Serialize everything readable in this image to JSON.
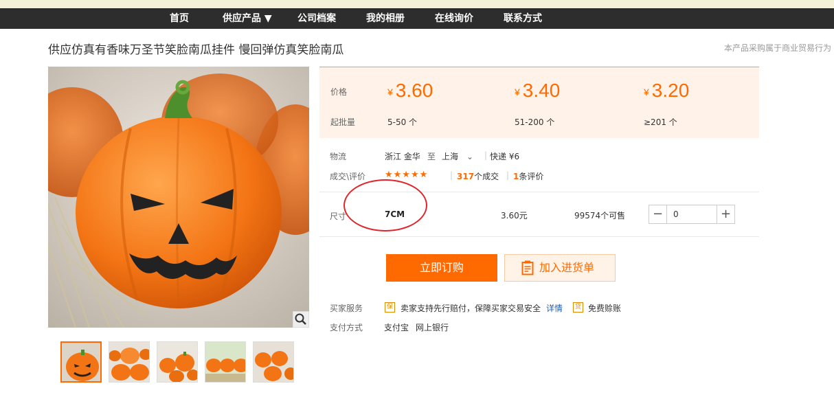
{
  "nav": {
    "items": [
      {
        "label": "首页"
      },
      {
        "label": "供应产品 ▼"
      },
      {
        "label": "公司档案"
      },
      {
        "label": "我的相册"
      },
      {
        "label": "在线询价"
      },
      {
        "label": "联系方式"
      }
    ]
  },
  "product": {
    "title": "供应仿真有香味万圣节笑脸南瓜挂件 慢回弹仿真笑脸南瓜",
    "disclaimer": "本产品采购属于商业贸易行为"
  },
  "pricing": {
    "price_label": "价格",
    "moq_label": "起批量",
    "currency": "¥",
    "tiers": [
      {
        "price": "3.60",
        "range": "5-50 个"
      },
      {
        "price": "3.40",
        "range": "51-200 个"
      },
      {
        "price": "3.20",
        "range": "≥201 个"
      }
    ]
  },
  "logistics": {
    "label": "物流",
    "from": "浙江 金华",
    "to_word": "至",
    "destination": "上海",
    "shipping": "快递 ¥6"
  },
  "reviews": {
    "label": "成交\\评价",
    "stars": "★★★★★",
    "deals_count": "317",
    "deals_suffix": "个成交",
    "review_count": "1",
    "review_suffix": "条评价"
  },
  "sku": {
    "label": "尺寸",
    "name": "7CM",
    "price": "3.60元",
    "stock": "99574个可售",
    "quantity": "0",
    "minus": "−",
    "plus": "+"
  },
  "actions": {
    "order_label": "立即订购",
    "cart_label": "加入进货单"
  },
  "services": {
    "buyer_label": "买家服务",
    "guarantee_icon": "保",
    "guarantee_text": "卖家支持先行赔付，保障买家交易安全",
    "detail_link": "详情",
    "free_icon": "贷",
    "free_text": "免费赊账",
    "payment_label": "支付方式",
    "payment_methods": [
      "支付宝",
      "网上银行"
    ]
  },
  "colors": {
    "accent": "#ff6a00",
    "nav_bg": "#2d2d2d",
    "price_bg": "#fff2e8",
    "annotation": "#e0252a"
  }
}
